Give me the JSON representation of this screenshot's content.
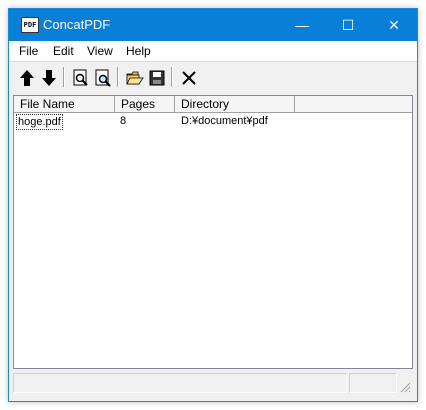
{
  "window": {
    "title": "ConcatPDF",
    "app_icon_text": "PDF"
  },
  "titlebar_buttons": {
    "minimize": "—",
    "maximize": "☐",
    "close": "✕"
  },
  "menu": {
    "file": "File",
    "edit": "Edit",
    "view": "View",
    "help": "Help"
  },
  "toolbar": {
    "icons": [
      "move-up-icon",
      "move-down-icon",
      "preview-icon",
      "search-icon",
      "open-folder-icon",
      "save-icon",
      "delete-icon"
    ]
  },
  "list": {
    "columns": [
      "File Name",
      "Pages",
      "Directory"
    ],
    "rows": [
      {
        "file_name": "hoge.pdf",
        "pages": "8",
        "directory": "D:¥document¥pdf"
      }
    ]
  },
  "colors": {
    "titlebar": "#0a7fd8",
    "window_bg": "#f0f0f0"
  }
}
